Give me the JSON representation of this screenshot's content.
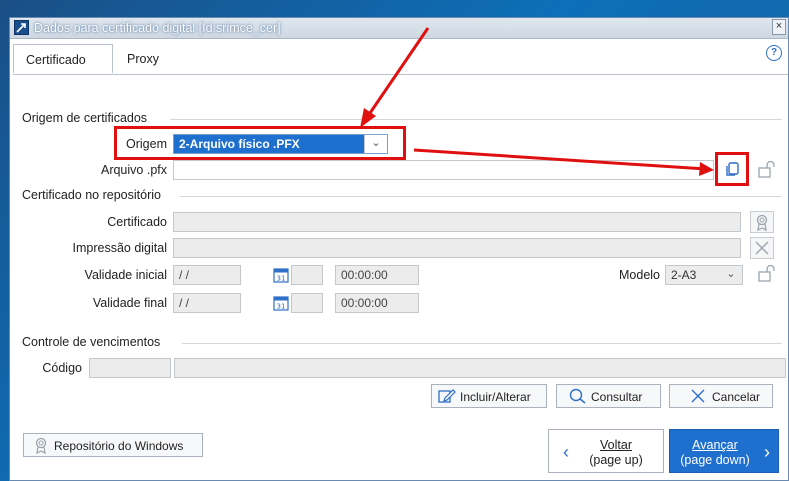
{
  "window": {
    "title": "Dados para certificado digital [Id:srimce_cer]",
    "close_glyph": "×"
  },
  "tabs": [
    {
      "label": "Certificado",
      "active": true
    },
    {
      "label": "Proxy",
      "active": false
    }
  ],
  "help_glyph": "?",
  "origem_section": {
    "title": "Origem de certificados",
    "origem_label": "Origem",
    "origem_value": "2-Arquivo físico .PFX",
    "arquivo_label": "Arquivo .pfx",
    "arquivo_value": ""
  },
  "repo_section": {
    "title": "Certificado no repositório",
    "certificado_label": "Certificado",
    "impressao_label": "Impressão digital",
    "validade_inicial_label": "Validade inicial",
    "validade_inicial_date": "/ /",
    "validade_inicial_time": "00:00:00",
    "validade_final_label": "Validade final",
    "validade_final_date": "/ /",
    "validade_final_time": "00:00:00",
    "modelo_label": "Modelo",
    "modelo_value": "2-A3"
  },
  "venc_section": {
    "title": "Controle de vencimentos",
    "codigo_label": "Código"
  },
  "buttons": {
    "incluir": "Incluir/Alterar",
    "consultar": "Consultar",
    "cancelar": "Cancelar",
    "repositorio": "Repositório do Windows",
    "voltar_line1": "Voltar",
    "voltar_line2": "(page up)",
    "avancar_line1": "Avançar",
    "avancar_line2": "(page down)"
  },
  "colors": {
    "accent": "#1f6fcf",
    "annotation": "#e01010"
  }
}
